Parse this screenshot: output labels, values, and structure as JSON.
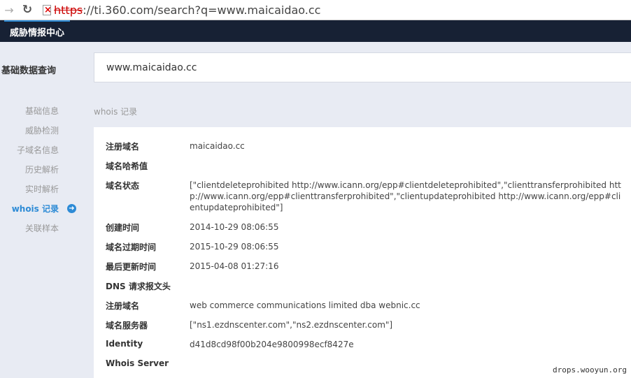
{
  "browser": {
    "url_scheme": "https",
    "url_rest": "://ti.360.com/search?q=www.maicaidao.cc"
  },
  "topbar": {
    "brand": "威胁情报中心"
  },
  "sidebar": {
    "title": "基础数据查询",
    "items": [
      {
        "label": "基础信息"
      },
      {
        "label": "威胁检测"
      },
      {
        "label": "子域名信息"
      },
      {
        "label": "历史解析"
      },
      {
        "label": "实时解析"
      },
      {
        "label": "whois 记录"
      },
      {
        "label": "关联样本"
      }
    ]
  },
  "search": {
    "value": "www.maicaidao.cc"
  },
  "section": {
    "title": "whois 记录"
  },
  "whois": {
    "rows": [
      {
        "key": "注册域名",
        "value": "maicaidao.cc"
      },
      {
        "key": "域名哈希值",
        "value": ""
      },
      {
        "key": "域名状态",
        "value": "[\"clientdeleteprohibited http://www.icann.org/epp#clientdeleteprohibited\",\"clienttransferprohibited http://www.icann.org/epp#clienttransferprohibited\",\"clientupdateprohibited http://www.icann.org/epp#clientupdateprohibited\"]"
      },
      {
        "key": "创建时间",
        "value": "2014-10-29 08:06:55"
      },
      {
        "key": "域名过期时间",
        "value": "2015-10-29 08:06:55"
      },
      {
        "key": "最后更新时间",
        "value": "2015-04-08 01:27:16"
      },
      {
        "key": "DNS 请求报文头",
        "value": ""
      },
      {
        "key": "注册域名",
        "value": "web commerce communications limited dba webnic.cc"
      },
      {
        "key": "域名服务器",
        "value": "[\"ns1.ezdnscenter.com\",\"ns2.ezdnscenter.com\"]"
      },
      {
        "key": "Identity",
        "value": "d41d8cd98f00b204e9800998ecf8427e"
      },
      {
        "key": "Whois Server",
        "value": ""
      }
    ]
  },
  "watermark": "drops.wooyun.org"
}
